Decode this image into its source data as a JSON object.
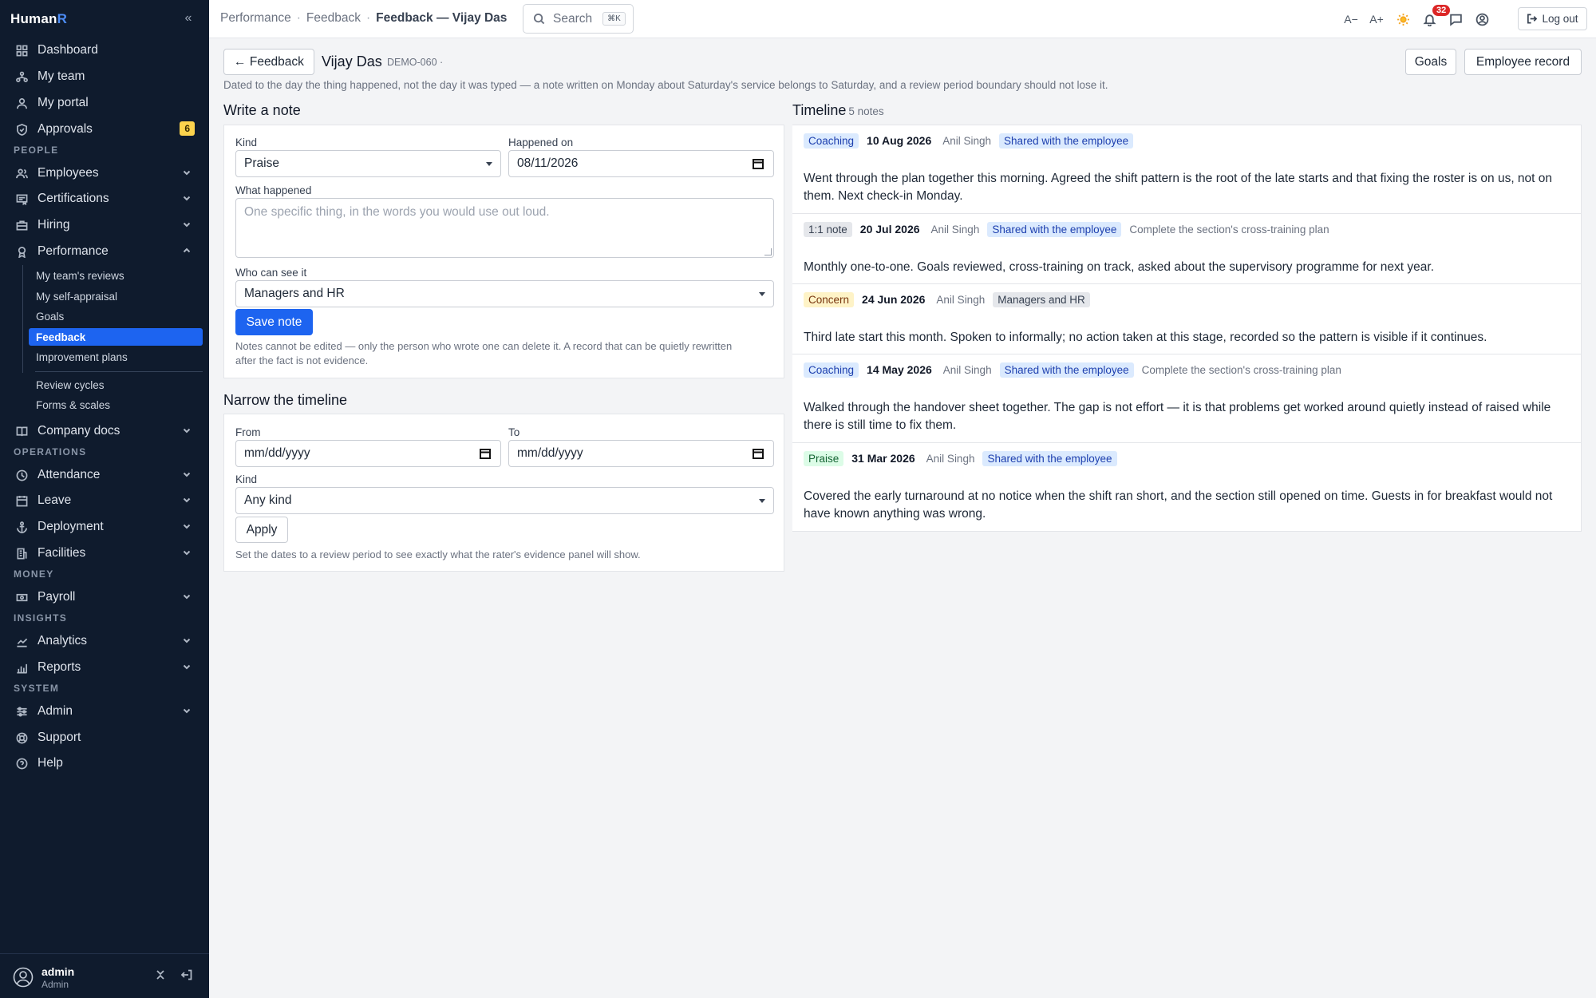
{
  "app": {
    "brand_main": "Human",
    "brand_accent": "R"
  },
  "sidebar": {
    "items": {
      "dashboard": "Dashboard",
      "my_team": "My team",
      "my_portal": "My portal",
      "approvals": "Approvals",
      "approvals_badge": "6",
      "employees": "Employees",
      "certifications": "Certifications",
      "hiring": "Hiring",
      "performance": "Performance",
      "company_docs": "Company docs",
      "attendance": "Attendance",
      "leave": "Leave",
      "deployment": "Deployment",
      "facilities": "Facilities",
      "payroll": "Payroll",
      "analytics": "Analytics",
      "reports": "Reports",
      "admin": "Admin",
      "support": "Support",
      "help": "Help"
    },
    "sections": {
      "people": "PEOPLE",
      "operations": "OPERATIONS",
      "money": "MONEY",
      "insights": "INSIGHTS",
      "system": "SYSTEM"
    },
    "performance_sub": {
      "teams_reviews": "My team's reviews",
      "self_appraisal": "My self-appraisal",
      "goals": "Goals",
      "feedback": "Feedback",
      "improvement_plans": "Improvement plans",
      "review_cycles": "Review cycles",
      "forms_scales": "Forms & scales"
    },
    "user": {
      "name": "admin",
      "role": "Admin"
    }
  },
  "topbar": {
    "crumb_1": "Performance",
    "crumb_2": "Feedback",
    "crumb_current": "Feedback — Vijay Das",
    "search_label": "Search",
    "search_shortcut": "⌘K",
    "font_smaller": "A−",
    "font_larger": "A+",
    "notification_count": "32",
    "logout_label": "Log out"
  },
  "header": {
    "back_label": "← Feedback",
    "employee_name": "Vijay Das",
    "employee_code": "DEMO-060 ·",
    "goals_button": "Goals",
    "employee_record_button": "Employee record",
    "intro": "Dated to the day the thing happened, not the day it was typed — a note written on Monday about Saturday's service belongs to Saturday, and a review period boundary should not lose it."
  },
  "write_note": {
    "title": "Write a note",
    "kind_label": "Kind",
    "kind_value": "Praise",
    "happened_label": "Happened on",
    "happened_value": "08/11/2026",
    "what_label": "What happened",
    "what_placeholder": "One specific thing, in the words you would use out loud.",
    "who_label": "Who can see it",
    "who_value": "Managers and HR",
    "save_label": "Save note",
    "help": "Notes cannot be edited — only the person who wrote one can delete it. A record that can be quietly rewritten after the fact is not evidence."
  },
  "narrow": {
    "title": "Narrow the timeline",
    "from_label": "From",
    "from_value": "mm/dd/yyyy",
    "to_label": "To",
    "to_value": "mm/dd/yyyy",
    "kind_label": "Kind",
    "kind_value": "Any kind",
    "apply_label": "Apply",
    "help": "Set the dates to a review period to see exactly what the rater's evidence panel will show."
  },
  "timeline": {
    "title": "Timeline",
    "count": "5 notes",
    "entries": [
      {
        "kind": "Coaching",
        "date": "10 Aug 2026",
        "author": "Anil Singh",
        "visibility": "Shared with the employee",
        "goal": "",
        "body": "Went through the plan together this morning. Agreed the shift pattern is the root of the late starts and that fixing the roster is on us, not on them. Next check-in Monday."
      },
      {
        "kind": "1:1 note",
        "date": "20 Jul 2026",
        "author": "Anil Singh",
        "visibility": "Shared with the employee",
        "goal": "Complete the section's cross-training plan",
        "body": "Monthly one-to-one. Goals reviewed, cross-training on track, asked about the supervisory programme for next year."
      },
      {
        "kind": "Concern",
        "date": "24 Jun 2026",
        "author": "Anil Singh",
        "visibility": "Managers and HR",
        "goal": "",
        "body": "Third late start this month. Spoken to informally; no action taken at this stage, recorded so the pattern is visible if it continues."
      },
      {
        "kind": "Coaching",
        "date": "14 May 2026",
        "author": "Anil Singh",
        "visibility": "Shared with the employee",
        "goal": "Complete the section's cross-training plan",
        "body": "Walked through the handover sheet together. The gap is not effort — it is that problems get worked around quietly instead of raised while there is still time to fix them."
      },
      {
        "kind": "Praise",
        "date": "31 Mar 2026",
        "author": "Anil Singh",
        "visibility": "Shared with the employee",
        "goal": "",
        "body": "Covered the early turnaround at no notice when the shift ran short, and the section still opened on time. Guests in for breakfast would not have known anything was wrong."
      }
    ]
  },
  "colors": {
    "sidebar_bg": "#0f1b2d",
    "accent": "#1d64f0",
    "badge": "#fcd34d",
    "notif": "#dc2626"
  }
}
